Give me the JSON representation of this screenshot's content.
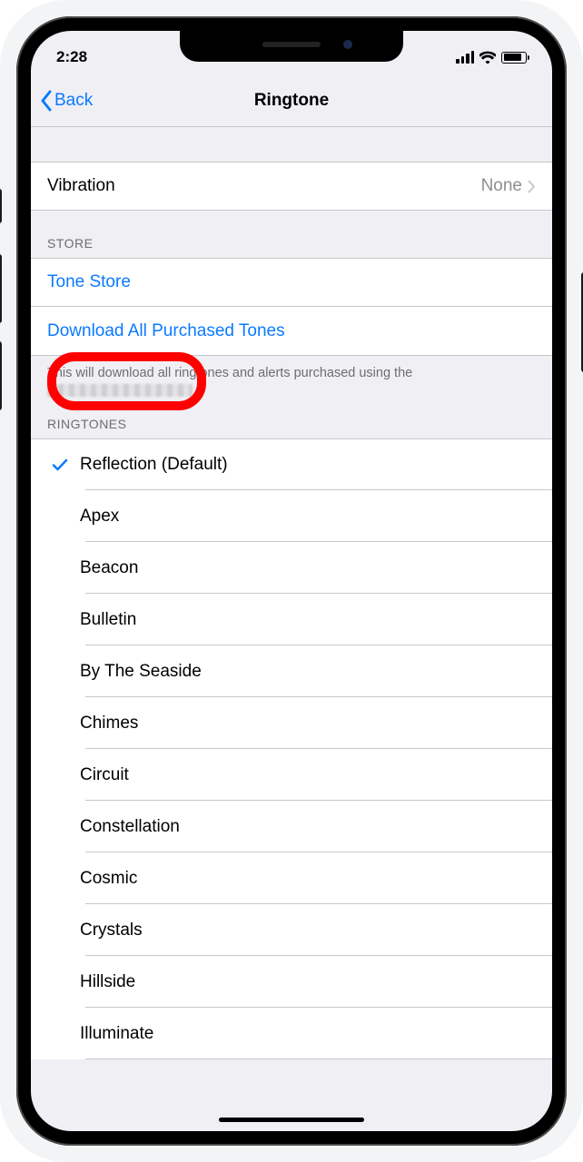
{
  "statusbar": {
    "time": "2:28"
  },
  "nav": {
    "back_label": "Back",
    "title": "Ringtone"
  },
  "vibration_row": {
    "label": "Vibration",
    "value": "None"
  },
  "store": {
    "header": "STORE",
    "tone_store_label": "Tone Store",
    "download_all_label": "Download All Purchased Tones",
    "footer_prefix": "This will download all ringtones and alerts purchased using the "
  },
  "ringtones": {
    "header": "RINGTONES",
    "selected_index": 0,
    "items": [
      {
        "label": "Reflection (Default)"
      },
      {
        "label": "Apex"
      },
      {
        "label": "Beacon"
      },
      {
        "label": "Bulletin"
      },
      {
        "label": "By The Seaside"
      },
      {
        "label": "Chimes"
      },
      {
        "label": "Circuit"
      },
      {
        "label": "Constellation"
      },
      {
        "label": "Cosmic"
      },
      {
        "label": "Crystals"
      },
      {
        "label": "Hillside"
      },
      {
        "label": "Illuminate"
      }
    ]
  }
}
